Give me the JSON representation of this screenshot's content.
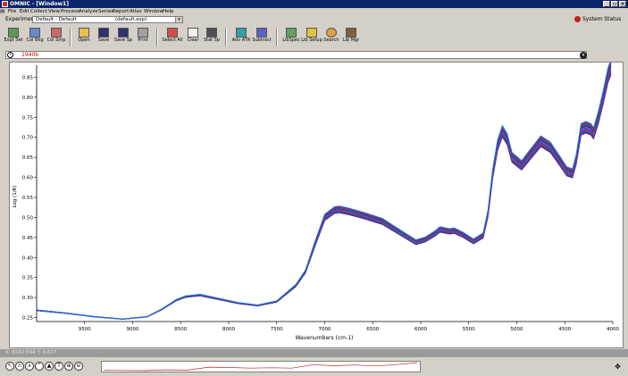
{
  "window": {
    "title": "OMNIC - [Window1]"
  },
  "menu": [
    "File",
    "Edit",
    "Collect",
    "View",
    "Process",
    "Analyze",
    "Series",
    "Report",
    "Atlas",
    "Window",
    "Help"
  ],
  "experiment": {
    "label": "Experiment",
    "value": "Default - Default",
    "file": "(default.exp)"
  },
  "system_status": "System Status",
  "toolbar": [
    {
      "label": "Expt Set",
      "icon": "experiment-setup-icon"
    },
    {
      "label": "Col Bkg",
      "icon": "collect-background-icon"
    },
    {
      "label": "Col Smp",
      "icon": "collect-sample-icon"
    },
    {
      "label": "Open",
      "icon": "open-folder-icon"
    },
    {
      "label": "Save",
      "icon": "save-disk-icon"
    },
    {
      "label": "Save Sp",
      "icon": "save-spectrum-icon"
    },
    {
      "label": "Print",
      "icon": "printer-icon"
    },
    {
      "label": "Select All",
      "icon": "select-all-icon"
    },
    {
      "label": "Clear",
      "icon": "clear-icon"
    },
    {
      "label": "Stat Sp",
      "icon": "statistical-spectra-icon"
    },
    {
      "label": "Adv ATR",
      "icon": "advanced-atr-icon"
    },
    {
      "label": "Subtract",
      "icon": "subtract-icon"
    },
    {
      "label": "LibSpec",
      "icon": "library-spectra-icon"
    },
    {
      "label": "Lib Setup",
      "icon": "library-setup-icon"
    },
    {
      "label": "Search",
      "icon": "search-magnifier-icon"
    },
    {
      "label": "Lib Mgr",
      "icon": "library-manager-icon"
    }
  ],
  "spectrum_selector": {
    "value": "1940b"
  },
  "status": {
    "cursor": "X: 8242.694  Y: 0.627"
  },
  "bottom_tools": [
    "arrow",
    "region",
    "peak-height",
    "peak-area",
    "label",
    "text",
    "zoom"
  ],
  "chart_data": {
    "type": "line",
    "ylabel": "Log (1/R)",
    "xlabel": "Wavenumbers (cm-1)",
    "xlim": [
      10000,
      4000
    ],
    "ylim": [
      0.24,
      0.88
    ],
    "x_ticks": [
      9500,
      9000,
      8500,
      8000,
      7500,
      7000,
      6500,
      6000,
      5500,
      5000,
      4500,
      4000
    ],
    "y_ticks": [
      0.25,
      0.3,
      0.35,
      0.4,
      0.45,
      0.5,
      0.55,
      0.6,
      0.65,
      0.7,
      0.75,
      0.8,
      0.85
    ],
    "x": [
      10000,
      9700,
      9400,
      9100,
      8850,
      8700,
      8600,
      8550,
      8450,
      8300,
      8100,
      7900,
      7700,
      7500,
      7300,
      7200,
      7100,
      7000,
      6900,
      6850,
      6750,
      6600,
      6400,
      6200,
      6050,
      5950,
      5850,
      5800,
      5700,
      5650,
      5550,
      5450,
      5350,
      5300,
      5250,
      5200,
      5150,
      5100,
      5050,
      4950,
      4850,
      4750,
      4650,
      4550,
      4480,
      4420,
      4380,
      4330,
      4280,
      4230,
      4200,
      4150,
      4100,
      4050,
      4020
    ],
    "y": [
      0.268,
      0.261,
      0.252,
      0.246,
      0.252,
      0.27,
      0.285,
      0.293,
      0.302,
      0.306,
      0.296,
      0.286,
      0.28,
      0.29,
      0.33,
      0.365,
      0.435,
      0.5,
      0.518,
      0.52,
      0.515,
      0.505,
      0.49,
      0.46,
      0.438,
      0.445,
      0.46,
      0.47,
      0.465,
      0.467,
      0.455,
      0.44,
      0.455,
      0.51,
      0.61,
      0.68,
      0.715,
      0.695,
      0.65,
      0.63,
      0.66,
      0.69,
      0.675,
      0.64,
      0.615,
      0.61,
      0.645,
      0.72,
      0.725,
      0.72,
      0.71,
      0.75,
      0.8,
      0.855,
      0.875
    ],
    "mini": [
      0.268,
      0.252,
      0.246,
      0.306,
      0.28,
      0.52,
      0.49,
      0.438,
      0.47,
      0.44,
      0.715,
      0.63,
      0.69,
      0.61,
      0.725,
      0.875
    ],
    "series_count": 18,
    "colors": [
      "#b000b0",
      "#0000d0",
      "#00a0a0",
      "#008000",
      "#d00000",
      "#ff00ff",
      "#404040",
      "#0080ff",
      "#a000ff",
      "#00c080"
    ],
    "grid": false
  }
}
